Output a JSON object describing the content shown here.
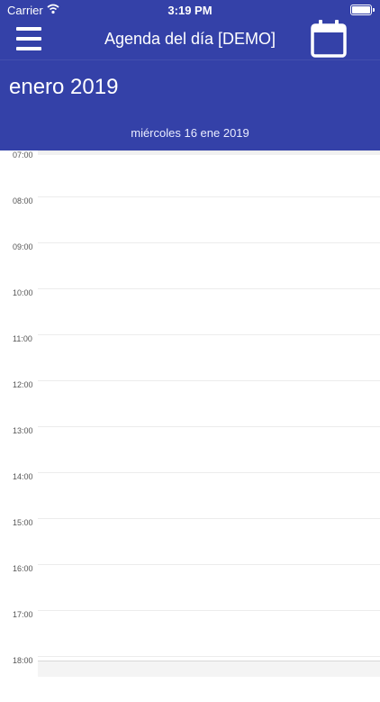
{
  "status_bar": {
    "carrier": "Carrier",
    "time": "3:19 PM"
  },
  "nav": {
    "title": "Agenda del día [DEMO]"
  },
  "header": {
    "month": "enero 2019",
    "date": "miércoles  16 ene 2019"
  },
  "timeline": {
    "hours": [
      "07:00",
      "08:00",
      "09:00",
      "10:00",
      "11:00",
      "12:00",
      "13:00",
      "14:00",
      "15:00",
      "16:00",
      "17:00",
      "18:00"
    ]
  },
  "colors": {
    "primary": "#3441a8",
    "background": "#ffffff"
  },
  "icons": [
    "wifi-icon",
    "battery-icon",
    "menu-icon",
    "calendar-icon"
  ]
}
